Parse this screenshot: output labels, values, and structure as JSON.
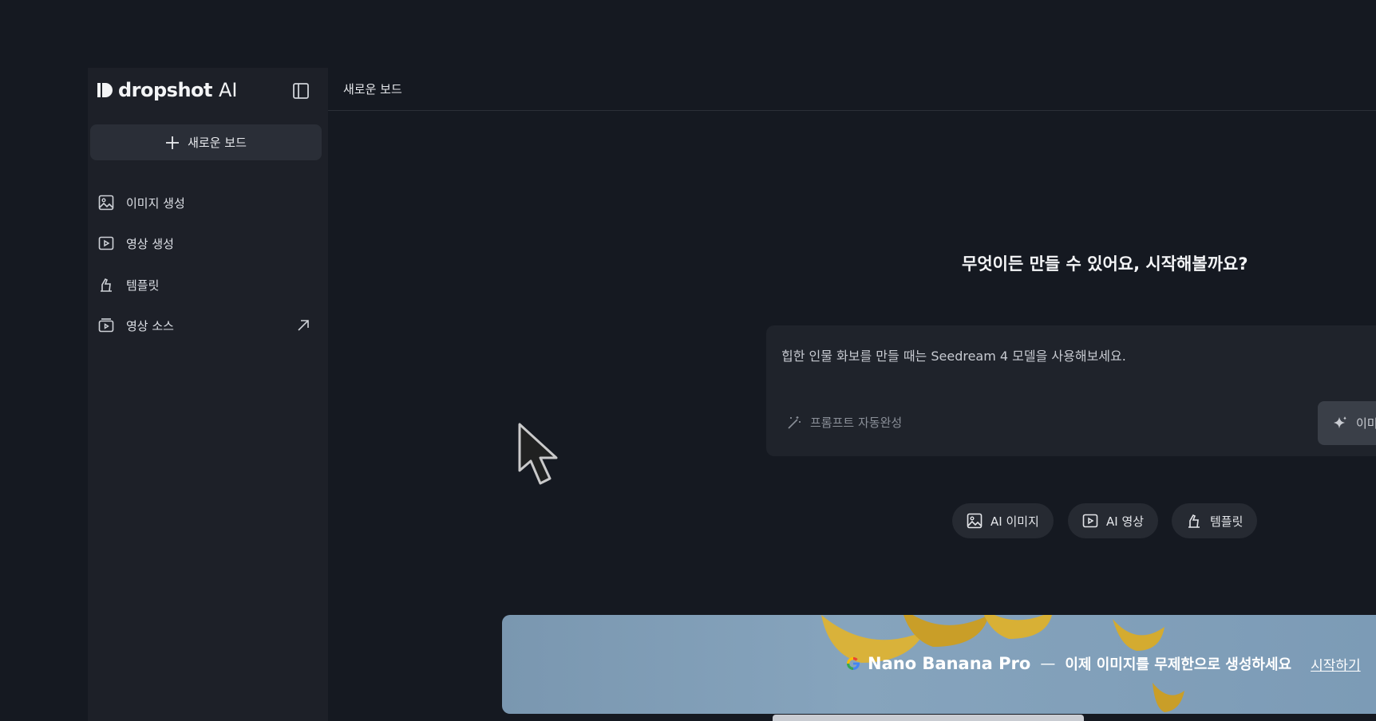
{
  "brand": {
    "name": "dropshot",
    "suffix": "AI"
  },
  "sidebar": {
    "new_board_label": "새로운 보드",
    "items": [
      {
        "label": "이미지 생성",
        "icon": "image-icon"
      },
      {
        "label": "영상 생성",
        "icon": "video-play-icon"
      },
      {
        "label": "템플릿",
        "icon": "template-icon"
      },
      {
        "label": "영상 소스",
        "icon": "video-source-icon",
        "external": true
      }
    ]
  },
  "main": {
    "board_title": "새로운 보드",
    "headline": "무엇이든 만들 수 있어요, 시작해볼까요?",
    "prompt": {
      "placeholder": "힙한 인물 화보를 만들 때는 Seedream 4 모델을 사용해보세요.",
      "autocomplete_label": "프롬프트 자동완성",
      "generate_label": "이미"
    },
    "chips": [
      {
        "label": "AI 이미지",
        "icon": "image-icon"
      },
      {
        "label": "AI 영상",
        "icon": "video-play-icon"
      },
      {
        "label": "템플릿",
        "icon": "template-icon"
      }
    ],
    "banner": {
      "title": "Nano Banana Pro",
      "dash": "—",
      "description": "이제 이미지를 무제한으로 생성하세요",
      "cta": "시작하기"
    }
  },
  "colors": {
    "background": "#151921",
    "sidebar": "#1d2028",
    "accent": "#7a97b0"
  }
}
